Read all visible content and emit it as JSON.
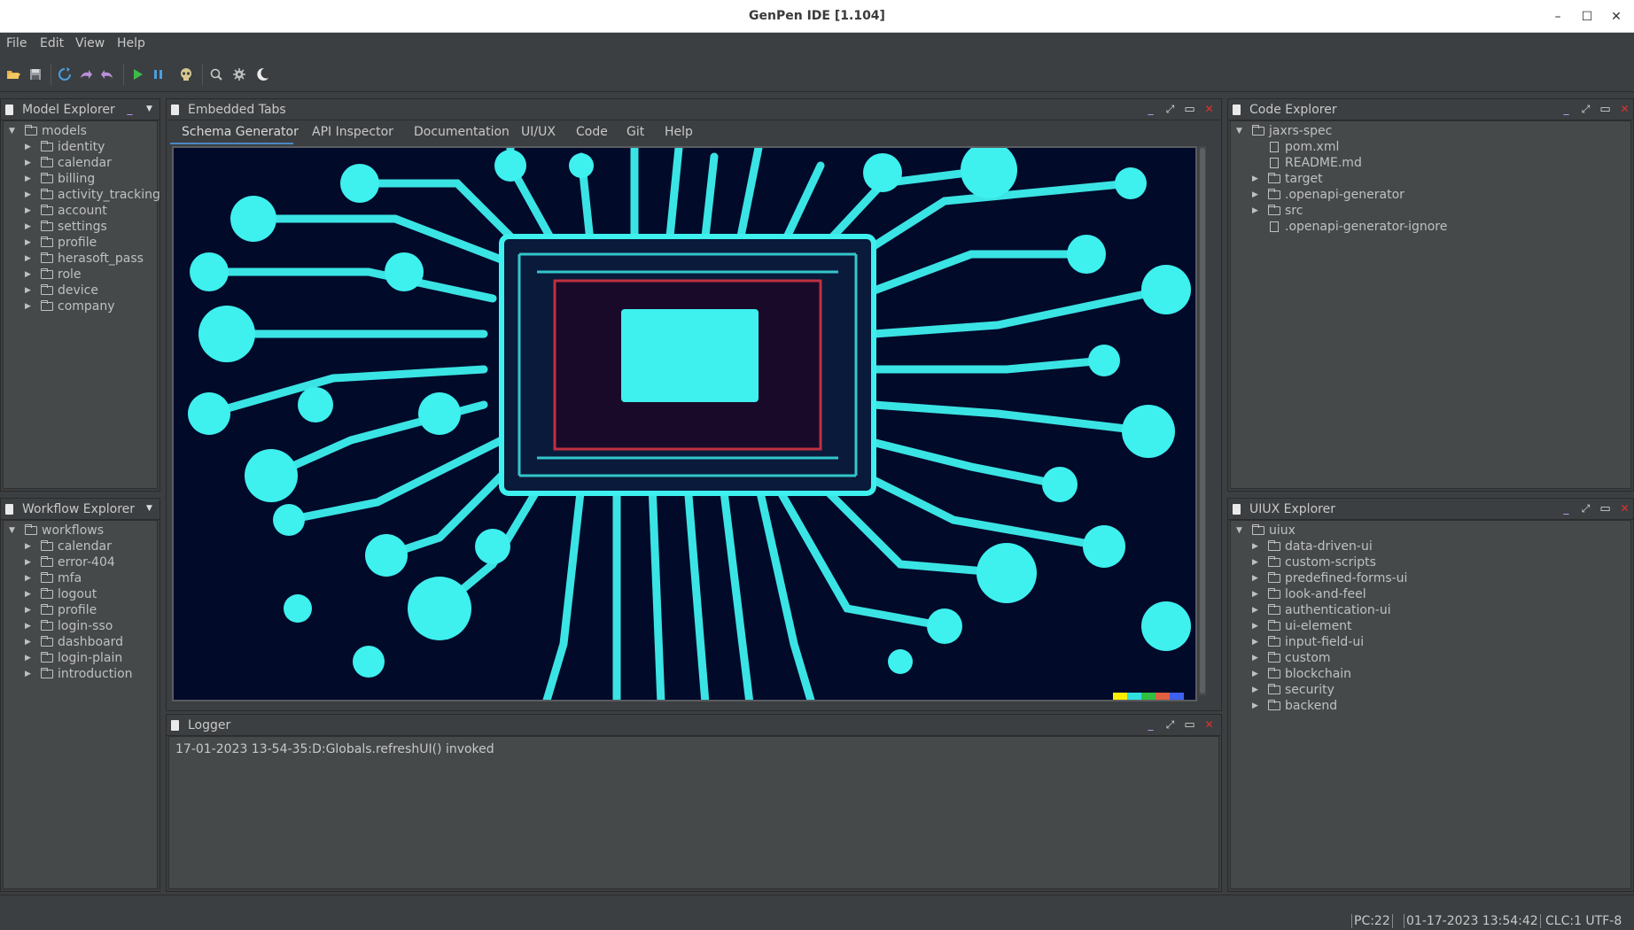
{
  "window": {
    "title": "GenPen IDE [1.104]",
    "controls": {
      "minimize": "–",
      "maximize": "☐",
      "close": "✕"
    }
  },
  "menu": [
    "File",
    "Edit",
    "View",
    "Help"
  ],
  "toolbar": {
    "icons": [
      "folder-open-icon",
      "save-icon",
      "refresh-icon",
      "redo-icon",
      "undo-icon",
      "run-icon",
      "pause-icon",
      "skull-icon",
      "search-icon",
      "gear-icon",
      "moon-icon"
    ]
  },
  "model_explorer": {
    "title": "Model Explorer",
    "root": "models",
    "items": [
      "identity",
      "calendar",
      "billing",
      "activity_tracking",
      "account",
      "settings",
      "profile",
      "herasoft_pass",
      "role",
      "device",
      "company"
    ]
  },
  "workflow_explorer": {
    "title": "Workflow Explorer",
    "root": "workflows",
    "items": [
      "calendar",
      "error-404",
      "mfa",
      "logout",
      "profile",
      "login-sso",
      "dashboard",
      "login-plain",
      "introduction"
    ]
  },
  "embedded_tabs": {
    "title": "Embedded Tabs",
    "tabs": [
      "Schema Generator",
      "API Inspector",
      "Documentation",
      "UI/UX",
      "Code",
      "Git",
      "Help"
    ],
    "active_tab": "Schema Generator"
  },
  "logger": {
    "title": "Logger",
    "lines": [
      "17-01-2023 13-54-35:D:Globals.refreshUI() invoked"
    ]
  },
  "code_explorer": {
    "title": "Code Explorer",
    "root": "jaxrs-spec",
    "items": [
      {
        "name": "pom.xml",
        "type": "file"
      },
      {
        "name": "README.md",
        "type": "file"
      },
      {
        "name": "target",
        "type": "folder"
      },
      {
        "name": ".openapi-generator",
        "type": "folder"
      },
      {
        "name": "src",
        "type": "folder"
      },
      {
        "name": ".openapi-generator-ignore",
        "type": "file"
      }
    ]
  },
  "uiux_explorer": {
    "title": "UIUX Explorer",
    "root": "uiux",
    "items": [
      "data-driven-ui",
      "custom-scripts",
      "predefined-forms-ui",
      "look-and-feel",
      "authentication-ui",
      "ui-element",
      "input-field-ui",
      "custom",
      "blockchain",
      "security",
      "backend"
    ]
  },
  "status": {
    "pc": "PC:22",
    "datetime": "01-17-2023 13:54:42",
    "clc": "CLC:1 UTF-8"
  },
  "colors": {
    "accent": "#4a88c7",
    "circuit": "#3ef0ee",
    "circuit_bg": "#020a2a",
    "close_red": "#e03030",
    "run_green": "#3dbb4a"
  }
}
